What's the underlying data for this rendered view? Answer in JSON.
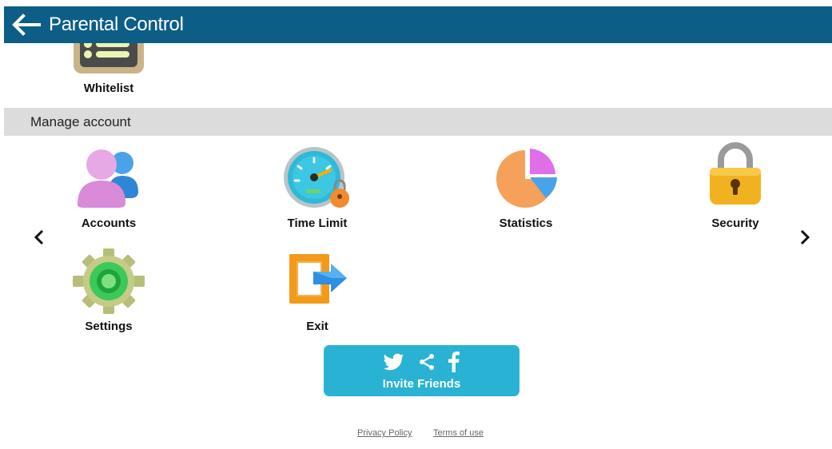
{
  "header": {
    "title": "Parental Control",
    "back_icon": "back-arrow-icon"
  },
  "top_section": {
    "items": [
      {
        "label": "Whitelist",
        "icon": "whitelist-icon"
      }
    ]
  },
  "manage_section": {
    "title": "Manage account",
    "items": [
      {
        "label": "Accounts",
        "icon": "accounts-icon"
      },
      {
        "label": "Time Limit",
        "icon": "time-limit-icon"
      },
      {
        "label": "Statistics",
        "icon": "statistics-icon"
      },
      {
        "label": "Security",
        "icon": "security-icon"
      },
      {
        "label": "Settings",
        "icon": "settings-icon"
      },
      {
        "label": "Exit",
        "icon": "exit-icon"
      }
    ],
    "prev_icon": "chevron-left-icon",
    "next_icon": "chevron-right-icon"
  },
  "invite": {
    "label": "Invite Friends",
    "icons": [
      "twitter-icon",
      "share-icon",
      "facebook-icon"
    ],
    "color": "#29b2d3"
  },
  "footer": {
    "privacy": "Privacy Policy",
    "terms": "Terms of use"
  },
  "colors": {
    "header_bg": "#0c5e87",
    "section_bg": "#dcdcdc"
  }
}
